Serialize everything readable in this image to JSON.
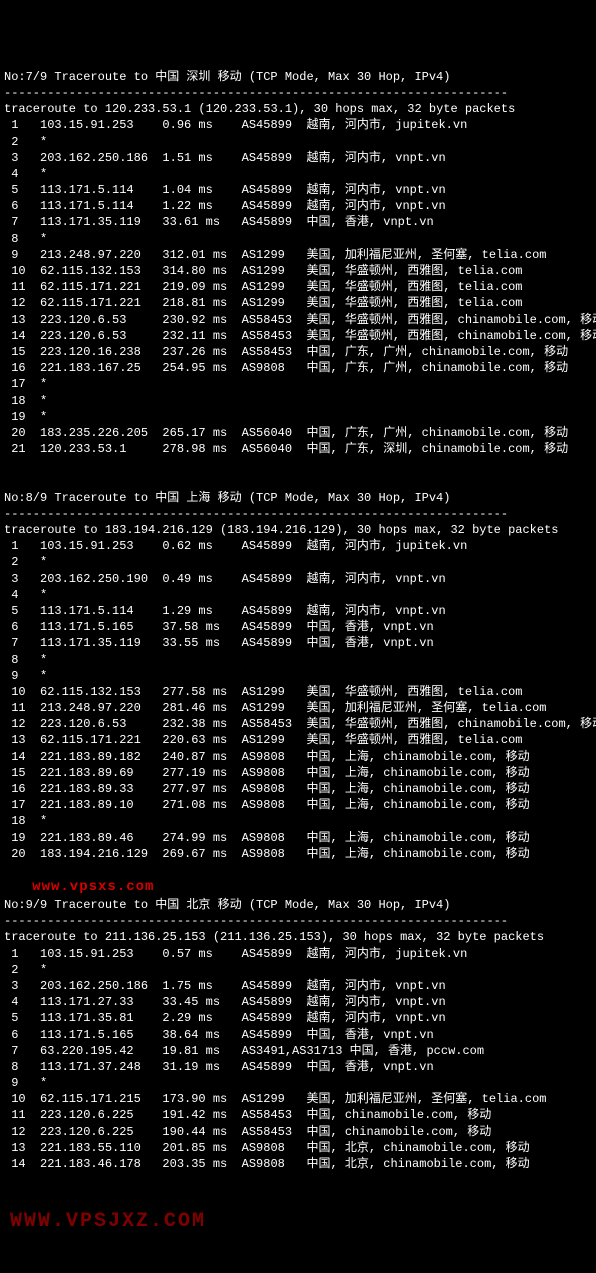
{
  "divider": "----------------------------------------------------------------------",
  "watermark1": "www.vpsxs.com",
  "watermark2": "WWW.VPSJXZ.COM",
  "traces": [
    {
      "header": "No:7/9 Traceroute to 中国 深圳 移动 (TCP Mode, Max 30 Hop, IPv4)",
      "cmd": "traceroute to 120.233.53.1 (120.233.53.1), 30 hops max, 32 byte packets",
      "hops": [
        {
          "n": "1",
          "ip": "103.15.91.253",
          "rtt": "0.96 ms",
          "asn": "AS45899",
          "loc": "越南, 河内市, jupitek.vn"
        },
        {
          "n": "2",
          "ip": "*",
          "rtt": "",
          "asn": "",
          "loc": ""
        },
        {
          "n": "3",
          "ip": "203.162.250.186",
          "rtt": "1.51 ms",
          "asn": "AS45899",
          "loc": "越南, 河内市, vnpt.vn"
        },
        {
          "n": "4",
          "ip": "*",
          "rtt": "",
          "asn": "",
          "loc": ""
        },
        {
          "n": "5",
          "ip": "113.171.5.114",
          "rtt": "1.04 ms",
          "asn": "AS45899",
          "loc": "越南, 河内市, vnpt.vn"
        },
        {
          "n": "6",
          "ip": "113.171.5.114",
          "rtt": "1.22 ms",
          "asn": "AS45899",
          "loc": "越南, 河内市, vnpt.vn"
        },
        {
          "n": "7",
          "ip": "113.171.35.119",
          "rtt": "33.61 ms",
          "asn": "AS45899",
          "loc": "中国, 香港, vnpt.vn"
        },
        {
          "n": "8",
          "ip": "*",
          "rtt": "",
          "asn": "",
          "loc": ""
        },
        {
          "n": "9",
          "ip": "213.248.97.220",
          "rtt": "312.01 ms",
          "asn": "AS1299",
          "loc": "美国, 加利福尼亚州, 圣何塞, telia.com"
        },
        {
          "n": "10",
          "ip": "62.115.132.153",
          "rtt": "314.80 ms",
          "asn": "AS1299",
          "loc": "美国, 华盛顿州, 西雅图, telia.com"
        },
        {
          "n": "11",
          "ip": "62.115.171.221",
          "rtt": "219.09 ms",
          "asn": "AS1299",
          "loc": "美国, 华盛顿州, 西雅图, telia.com"
        },
        {
          "n": "12",
          "ip": "62.115.171.221",
          "rtt": "218.81 ms",
          "asn": "AS1299",
          "loc": "美国, 华盛顿州, 西雅图, telia.com"
        },
        {
          "n": "13",
          "ip": "223.120.6.53",
          "rtt": "230.92 ms",
          "asn": "AS58453",
          "loc": "美国, 华盛顿州, 西雅图, chinamobile.com, 移动"
        },
        {
          "n": "14",
          "ip": "223.120.6.53",
          "rtt": "232.11 ms",
          "asn": "AS58453",
          "loc": "美国, 华盛顿州, 西雅图, chinamobile.com, 移动"
        },
        {
          "n": "15",
          "ip": "223.120.16.238",
          "rtt": "237.26 ms",
          "asn": "AS58453",
          "loc": "中国, 广东, 广州, chinamobile.com, 移动"
        },
        {
          "n": "16",
          "ip": "221.183.167.25",
          "rtt": "254.95 ms",
          "asn": "AS9808",
          "loc": "中国, 广东, 广州, chinamobile.com, 移动"
        },
        {
          "n": "17",
          "ip": "*",
          "rtt": "",
          "asn": "",
          "loc": ""
        },
        {
          "n": "18",
          "ip": "*",
          "rtt": "",
          "asn": "",
          "loc": ""
        },
        {
          "n": "19",
          "ip": "*",
          "rtt": "",
          "asn": "",
          "loc": ""
        },
        {
          "n": "20",
          "ip": "183.235.226.205",
          "rtt": "265.17 ms",
          "asn": "AS56040",
          "loc": "中国, 广东, 广州, chinamobile.com, 移动"
        },
        {
          "n": "21",
          "ip": "120.233.53.1",
          "rtt": "278.98 ms",
          "asn": "AS56040",
          "loc": "中国, 广东, 深圳, chinamobile.com, 移动"
        }
      ]
    },
    {
      "header": "No:8/9 Traceroute to 中国 上海 移动 (TCP Mode, Max 30 Hop, IPv4)",
      "cmd": "traceroute to 183.194.216.129 (183.194.216.129), 30 hops max, 32 byte packets",
      "hops": [
        {
          "n": "1",
          "ip": "103.15.91.253",
          "rtt": "0.62 ms",
          "asn": "AS45899",
          "loc": "越南, 河内市, jupitek.vn"
        },
        {
          "n": "2",
          "ip": "*",
          "rtt": "",
          "asn": "",
          "loc": ""
        },
        {
          "n": "3",
          "ip": "203.162.250.190",
          "rtt": "0.49 ms",
          "asn": "AS45899",
          "loc": "越南, 河内市, vnpt.vn"
        },
        {
          "n": "4",
          "ip": "*",
          "rtt": "",
          "asn": "",
          "loc": ""
        },
        {
          "n": "5",
          "ip": "113.171.5.114",
          "rtt": "1.29 ms",
          "asn": "AS45899",
          "loc": "越南, 河内市, vnpt.vn"
        },
        {
          "n": "6",
          "ip": "113.171.5.165",
          "rtt": "37.58 ms",
          "asn": "AS45899",
          "loc": "中国, 香港, vnpt.vn"
        },
        {
          "n": "7",
          "ip": "113.171.35.119",
          "rtt": "33.55 ms",
          "asn": "AS45899",
          "loc": "中国, 香港, vnpt.vn"
        },
        {
          "n": "8",
          "ip": "*",
          "rtt": "",
          "asn": "",
          "loc": ""
        },
        {
          "n": "9",
          "ip": "*",
          "rtt": "",
          "asn": "",
          "loc": ""
        },
        {
          "n": "10",
          "ip": "62.115.132.153",
          "rtt": "277.58 ms",
          "asn": "AS1299",
          "loc": "美国, 华盛顿州, 西雅图, telia.com"
        },
        {
          "n": "11",
          "ip": "213.248.97.220",
          "rtt": "281.46 ms",
          "asn": "AS1299",
          "loc": "美国, 加利福尼亚州, 圣何塞, telia.com"
        },
        {
          "n": "12",
          "ip": "223.120.6.53",
          "rtt": "232.38 ms",
          "asn": "AS58453",
          "loc": "美国, 华盛顿州, 西雅图, chinamobile.com, 移动"
        },
        {
          "n": "13",
          "ip": "62.115.171.221",
          "rtt": "220.63 ms",
          "asn": "AS1299",
          "loc": "美国, 华盛顿州, 西雅图, telia.com"
        },
        {
          "n": "14",
          "ip": "221.183.89.182",
          "rtt": "240.87 ms",
          "asn": "AS9808",
          "loc": "中国, 上海, chinamobile.com, 移动"
        },
        {
          "n": "15",
          "ip": "221.183.89.69",
          "rtt": "277.19 ms",
          "asn": "AS9808",
          "loc": "中国, 上海, chinamobile.com, 移动"
        },
        {
          "n": "16",
          "ip": "221.183.89.33",
          "rtt": "277.97 ms",
          "asn": "AS9808",
          "loc": "中国, 上海, chinamobile.com, 移动"
        },
        {
          "n": "17",
          "ip": "221.183.89.10",
          "rtt": "271.08 ms",
          "asn": "AS9808",
          "loc": "中国, 上海, chinamobile.com, 移动"
        },
        {
          "n": "18",
          "ip": "*",
          "rtt": "",
          "asn": "",
          "loc": ""
        },
        {
          "n": "19",
          "ip": "221.183.89.46",
          "rtt": "274.99 ms",
          "asn": "AS9808",
          "loc": "中国, 上海, chinamobile.com, 移动"
        },
        {
          "n": "20",
          "ip": "183.194.216.129",
          "rtt": "269.67 ms",
          "asn": "AS9808",
          "loc": "中国, 上海, chinamobile.com, 移动"
        }
      ]
    },
    {
      "header": "No:9/9 Traceroute to 中国 北京 移动 (TCP Mode, Max 30 Hop, IPv4)",
      "cmd": "traceroute to 211.136.25.153 (211.136.25.153), 30 hops max, 32 byte packets",
      "hops": [
        {
          "n": "1",
          "ip": "103.15.91.253",
          "rtt": "0.57 ms",
          "asn": "AS45899",
          "loc": "越南, 河内市, jupitek.vn"
        },
        {
          "n": "2",
          "ip": "*",
          "rtt": "",
          "asn": "",
          "loc": ""
        },
        {
          "n": "3",
          "ip": "203.162.250.186",
          "rtt": "1.75 ms",
          "asn": "AS45899",
          "loc": "越南, 河内市, vnpt.vn"
        },
        {
          "n": "4",
          "ip": "113.171.27.33",
          "rtt": "33.45 ms",
          "asn": "AS45899",
          "loc": "越南, 河内市, vnpt.vn"
        },
        {
          "n": "5",
          "ip": "113.171.35.81",
          "rtt": "2.29 ms",
          "asn": "AS45899",
          "loc": "越南, 河内市, vnpt.vn"
        },
        {
          "n": "6",
          "ip": "113.171.5.165",
          "rtt": "38.64 ms",
          "asn": "AS45899",
          "loc": "中国, 香港, vnpt.vn"
        },
        {
          "n": "7",
          "ip": "63.220.195.42",
          "rtt": "19.81 ms",
          "asn": "AS3491,AS31713",
          "loc": "中国, 香港, pccw.com"
        },
        {
          "n": "8",
          "ip": "113.171.37.248",
          "rtt": "31.19 ms",
          "asn": "AS45899",
          "loc": "中国, 香港, vnpt.vn"
        },
        {
          "n": "9",
          "ip": "*",
          "rtt": "",
          "asn": "",
          "loc": ""
        },
        {
          "n": "10",
          "ip": "62.115.171.215",
          "rtt": "173.90 ms",
          "asn": "AS1299",
          "loc": "美国, 加利福尼亚州, 圣何塞, telia.com"
        },
        {
          "n": "11",
          "ip": "223.120.6.225",
          "rtt": "191.42 ms",
          "asn": "AS58453",
          "loc": "中国, chinamobile.com, 移动"
        },
        {
          "n": "12",
          "ip": "223.120.6.225",
          "rtt": "190.44 ms",
          "asn": "AS58453",
          "loc": "中国, chinamobile.com, 移动"
        },
        {
          "n": "13",
          "ip": "221.183.55.110",
          "rtt": "201.85 ms",
          "asn": "AS9808",
          "loc": "中国, 北京, chinamobile.com, 移动"
        },
        {
          "n": "14",
          "ip": "221.183.46.178",
          "rtt": "203.35 ms",
          "asn": "AS9808",
          "loc": "中国, 北京, chinamobile.com, 移动"
        }
      ]
    }
  ]
}
